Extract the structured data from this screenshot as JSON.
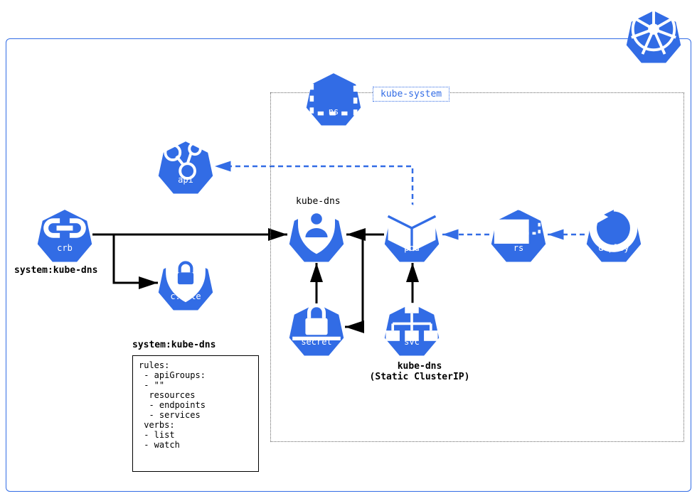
{
  "namespace_label": "kube-system",
  "nodes": {
    "crb": {
      "label": "crb",
      "caption": "system:kube-dns"
    },
    "api": {
      "label": "api"
    },
    "crole": {
      "label": "c.role"
    },
    "ns": {
      "label": "ns"
    },
    "sa": {
      "label": "sa",
      "caption": "kube-dns"
    },
    "pod": {
      "label": "pod"
    },
    "rs": {
      "label": "rs"
    },
    "deploy": {
      "label": "deploy"
    },
    "secret": {
      "label": "secret"
    },
    "svc": {
      "label": "svc",
      "caption": "kube-dns\n(Static ClusterIP)"
    }
  },
  "rules_title": "system:kube-dns",
  "rules_body": "rules:\n - apiGroups:\n - \"\"\n  resources\n  - endpoints\n  - services\n verbs:\n - list\n - watch"
}
